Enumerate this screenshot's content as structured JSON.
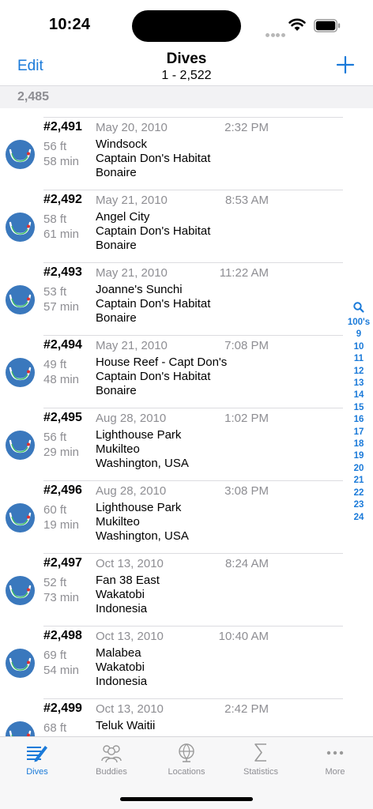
{
  "status": {
    "time": "10:24"
  },
  "nav": {
    "edit_label": "Edit",
    "title": "Dives",
    "subtitle": "1 - 2,522"
  },
  "section_header": "2,485",
  "dives": [
    {
      "number": "#2,491",
      "date": "May 20, 2010",
      "time": "2:32 PM",
      "depth": "56 ft",
      "duration": "58 min",
      "site": "Windsock",
      "place": "Captain Don's Habitat",
      "region": "Bonaire"
    },
    {
      "number": "#2,492",
      "date": "May 21, 2010",
      "time": "8:53 AM",
      "depth": "58 ft",
      "duration": "61 min",
      "site": "Angel City",
      "place": "Captain Don's Habitat",
      "region": "Bonaire"
    },
    {
      "number": "#2,493",
      "date": "May 21, 2010",
      "time": "11:22 AM",
      "depth": "53 ft",
      "duration": "57 min",
      "site": "Joanne's Sunchi",
      "place": "Captain Don's Habitat",
      "region": "Bonaire"
    },
    {
      "number": "#2,494",
      "date": "May 21, 2010",
      "time": "7:08 PM",
      "depth": "49 ft",
      "duration": "48 min",
      "site": "House Reef - Capt Don's",
      "place": "Captain Don's Habitat",
      "region": "Bonaire"
    },
    {
      "number": "#2,495",
      "date": "Aug 28, 2010",
      "time": "1:02 PM",
      "depth": "56 ft",
      "duration": "29 min",
      "site": "Lighthouse Park",
      "place": "Mukilteo",
      "region": "Washington, USA"
    },
    {
      "number": "#2,496",
      "date": "Aug 28, 2010",
      "time": "3:08 PM",
      "depth": "60 ft",
      "duration": "19 min",
      "site": "Lighthouse Park",
      "place": "Mukilteo",
      "region": "Washington, USA"
    },
    {
      "number": "#2,497",
      "date": "Oct 13, 2010",
      "time": "8:24 AM",
      "depth": "52 ft",
      "duration": "73 min",
      "site": "Fan 38 East",
      "place": "Wakatobi",
      "region": "Indonesia"
    },
    {
      "number": "#2,498",
      "date": "Oct 13, 2010",
      "time": "10:40 AM",
      "depth": "69 ft",
      "duration": "54 min",
      "site": "Malabea",
      "place": "Wakatobi",
      "region": "Indonesia"
    },
    {
      "number": "#2,499",
      "date": "Oct 13, 2010",
      "time": "2:42 PM",
      "depth": "68 ft",
      "duration": "",
      "site": "Teluk Waitii",
      "place": "",
      "region": ""
    }
  ],
  "index": [
    "100's",
    "9",
    "10",
    "11",
    "12",
    "13",
    "14",
    "15",
    "16",
    "17",
    "18",
    "19",
    "20",
    "21",
    "22",
    "23",
    "24"
  ],
  "tabs": [
    {
      "label": "Dives",
      "icon": "dives-icon",
      "active": true
    },
    {
      "label": "Buddies",
      "icon": "buddies-icon",
      "active": false
    },
    {
      "label": "Locations",
      "icon": "globe-icon",
      "active": false
    },
    {
      "label": "Statistics",
      "icon": "sigma-icon",
      "active": false
    },
    {
      "label": "More",
      "icon": "ellipsis-icon",
      "active": false
    }
  ],
  "colors": {
    "accent": "#1a7ad9",
    "icon_fill": "#3a78bd",
    "secondary_text": "#8e8e93"
  }
}
